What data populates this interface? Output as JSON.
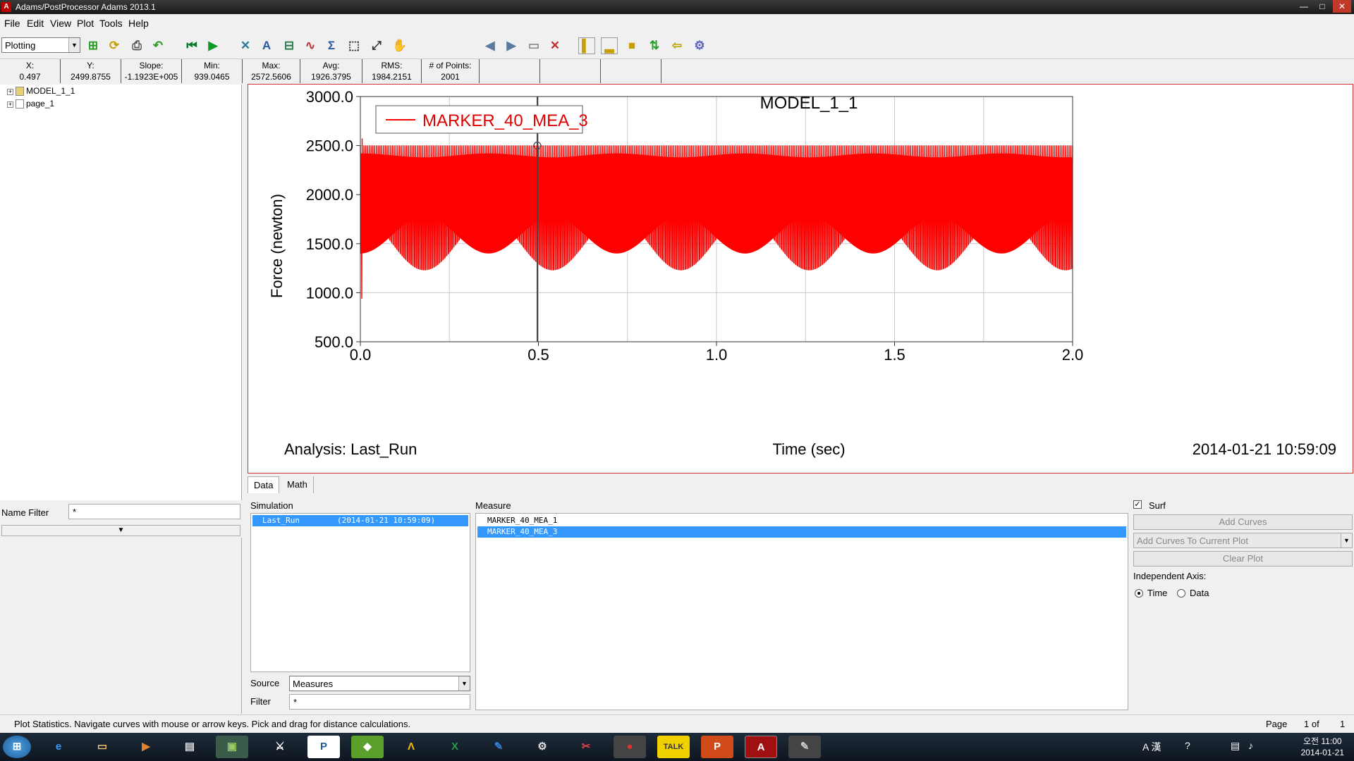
{
  "window": {
    "title": "Adams/PostProcessor Adams 2013.1",
    "minimize": "—",
    "maximize": "□",
    "close": "✕"
  },
  "menu": [
    "File",
    "Edit",
    "View",
    "Plot",
    "Tools",
    "Help"
  ],
  "toolbar": {
    "mode_select": "Plotting"
  },
  "stats": [
    {
      "label": "X:",
      "value": "0.497"
    },
    {
      "label": "Y:",
      "value": "2499.8755"
    },
    {
      "label": "Slope:",
      "value": "-1.1923E+005"
    },
    {
      "label": "Min:",
      "value": "939.0465"
    },
    {
      "label": "Max:",
      "value": "2572.5606"
    },
    {
      "label": "Avg:",
      "value": "1926.3795"
    },
    {
      "label": "RMS:",
      "value": "1984.2151"
    },
    {
      "label": "# of Points:",
      "value": "2001"
    }
  ],
  "tree": {
    "items": [
      {
        "label": "MODEL_1_1"
      },
      {
        "label": "page_1"
      }
    ]
  },
  "name_filter": {
    "label": "Name Filter",
    "value": "*"
  },
  "plot": {
    "analysis": "Analysis:  Last_Run",
    "timestamp": "2014-01-21 10:59:09"
  },
  "chart_data": {
    "type": "line",
    "title": "MODEL_1_1",
    "xlabel": "Time (sec)",
    "ylabel": "Force (newton)",
    "xlim": [
      0.0,
      2.0
    ],
    "ylim": [
      500.0,
      3000.0
    ],
    "xticks": [
      "0.0",
      "0.5",
      "1.0",
      "1.5",
      "2.0"
    ],
    "yticks": [
      "500.0",
      "1000.0",
      "1500.0",
      "2000.0",
      "2500.0",
      "3000.0"
    ],
    "grid": true,
    "legend_position": "top-left",
    "series": [
      {
        "name": "MARKER_40_MEA_3",
        "color": "#ff0000",
        "points": 2001,
        "min": 939.0465,
        "max": 2572.5606,
        "avg": 1926.3795,
        "upper_envelope": 2500.0,
        "lower_envelope_range": [
          1100.0,
          1700.0
        ]
      }
    ],
    "cursor": {
      "x": 0.497,
      "y": 2499.8755
    }
  },
  "tabs": [
    "Data",
    "Math"
  ],
  "data_panel": {
    "simulation_label": "Simulation",
    "simulation_name": "Last_Run",
    "simulation_time": "(2014-01-21 10:59:09)",
    "measure_label": "Measure",
    "measures": [
      {
        "label": "MARKER_40_MEA_1",
        "selected": false
      },
      {
        "label": "MARKER_40_MEA_3",
        "selected": true
      }
    ],
    "surf_label": "Surf",
    "add_curves": "Add Curves",
    "add_curves_mode": "Add Curves To Current Plot",
    "clear_plot": "Clear Plot",
    "independent_axis_label": "Independent Axis:",
    "axis_time": "Time",
    "axis_data": "Data",
    "source_label": "Source",
    "source_value": "Measures",
    "filter_label": "Filter",
    "filter_value": "*"
  },
  "statusbar": {
    "message": "Plot Statistics.  Navigate curves with mouse or arrow keys.  Pick and drag for distance calculations.",
    "page_label": "Page",
    "page_value": "1 of",
    "page_total": "1"
  },
  "taskbar": {
    "ime": "A 漢",
    "time": "오전 11:00",
    "date": "2014-01-21"
  }
}
